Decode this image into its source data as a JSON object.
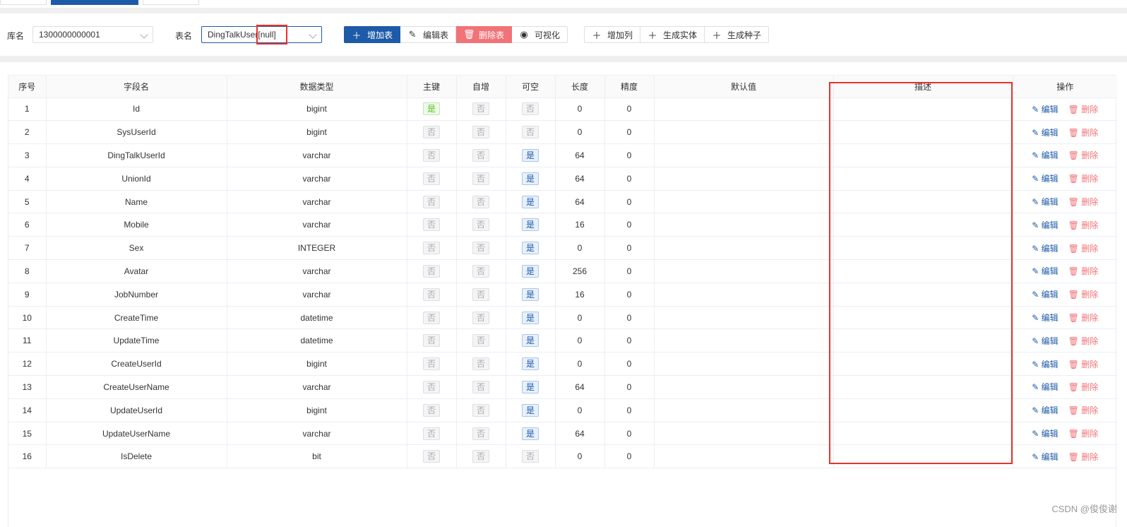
{
  "toolbar": {
    "db_label": "库名",
    "db_value": "1300000000001",
    "table_label": "表名",
    "table_value": "DingTalkUser[null]",
    "buttons_main": [
      {
        "icon": "plus-icon",
        "glyph": "＋",
        "label": "增加表"
      },
      {
        "icon": "edit-icon",
        "glyph": "✎",
        "label": "编辑表"
      },
      {
        "icon": "trash-icon",
        "glyph": "🗑",
        "label": "删除表"
      },
      {
        "icon": "eye-icon",
        "glyph": "◉",
        "label": "可视化"
      }
    ],
    "buttons_extra": [
      {
        "icon": "plus-icon",
        "glyph": "＋",
        "label": "增加列"
      },
      {
        "icon": "plus-icon",
        "glyph": "＋",
        "label": "生成实体"
      },
      {
        "icon": "plus-icon",
        "glyph": "＋",
        "label": "生成种子"
      }
    ]
  },
  "table": {
    "headers": [
      "序号",
      "字段名",
      "数据类型",
      "主键",
      "自增",
      "可空",
      "长度",
      "精度",
      "默认值",
      "描述",
      "操作"
    ],
    "yes": "是",
    "no": "否",
    "edit_label": "编辑",
    "delete_label": "删除",
    "rows": [
      {
        "no": "1",
        "name": "Id",
        "type": "bigint",
        "pk": true,
        "ai": false,
        "nullable": false,
        "length": "0",
        "precision": "0",
        "default": "",
        "desc": ""
      },
      {
        "no": "2",
        "name": "SysUserId",
        "type": "bigint",
        "pk": false,
        "ai": false,
        "nullable": false,
        "length": "0",
        "precision": "0",
        "default": "",
        "desc": ""
      },
      {
        "no": "3",
        "name": "DingTalkUserId",
        "type": "varchar",
        "pk": false,
        "ai": false,
        "nullable": true,
        "length": "64",
        "precision": "0",
        "default": "",
        "desc": ""
      },
      {
        "no": "4",
        "name": "UnionId",
        "type": "varchar",
        "pk": false,
        "ai": false,
        "nullable": true,
        "length": "64",
        "precision": "0",
        "default": "",
        "desc": ""
      },
      {
        "no": "5",
        "name": "Name",
        "type": "varchar",
        "pk": false,
        "ai": false,
        "nullable": true,
        "length": "64",
        "precision": "0",
        "default": "",
        "desc": ""
      },
      {
        "no": "6",
        "name": "Mobile",
        "type": "varchar",
        "pk": false,
        "ai": false,
        "nullable": true,
        "length": "16",
        "precision": "0",
        "default": "",
        "desc": ""
      },
      {
        "no": "7",
        "name": "Sex",
        "type": "INTEGER",
        "pk": false,
        "ai": false,
        "nullable": true,
        "length": "0",
        "precision": "0",
        "default": "",
        "desc": ""
      },
      {
        "no": "8",
        "name": "Avatar",
        "type": "varchar",
        "pk": false,
        "ai": false,
        "nullable": true,
        "length": "256",
        "precision": "0",
        "default": "",
        "desc": ""
      },
      {
        "no": "9",
        "name": "JobNumber",
        "type": "varchar",
        "pk": false,
        "ai": false,
        "nullable": true,
        "length": "16",
        "precision": "0",
        "default": "",
        "desc": ""
      },
      {
        "no": "10",
        "name": "CreateTime",
        "type": "datetime",
        "pk": false,
        "ai": false,
        "nullable": true,
        "length": "0",
        "precision": "0",
        "default": "",
        "desc": ""
      },
      {
        "no": "11",
        "name": "UpdateTime",
        "type": "datetime",
        "pk": false,
        "ai": false,
        "nullable": true,
        "length": "0",
        "precision": "0",
        "default": "",
        "desc": ""
      },
      {
        "no": "12",
        "name": "CreateUserId",
        "type": "bigint",
        "pk": false,
        "ai": false,
        "nullable": true,
        "length": "0",
        "precision": "0",
        "default": "",
        "desc": ""
      },
      {
        "no": "13",
        "name": "CreateUserName",
        "type": "varchar",
        "pk": false,
        "ai": false,
        "nullable": true,
        "length": "64",
        "precision": "0",
        "default": "",
        "desc": ""
      },
      {
        "no": "14",
        "name": "UpdateUserId",
        "type": "bigint",
        "pk": false,
        "ai": false,
        "nullable": true,
        "length": "0",
        "precision": "0",
        "default": "",
        "desc": ""
      },
      {
        "no": "15",
        "name": "UpdateUserName",
        "type": "varchar",
        "pk": false,
        "ai": false,
        "nullable": true,
        "length": "64",
        "precision": "0",
        "default": "",
        "desc": ""
      },
      {
        "no": "16",
        "name": "IsDelete",
        "type": "bit",
        "pk": false,
        "ai": false,
        "nullable": false,
        "length": "0",
        "precision": "0",
        "default": "",
        "desc": ""
      }
    ]
  },
  "watermark": "CSDN @俊俊谢",
  "colors": {
    "primary": "#1d5aa8",
    "danger": "#f07378",
    "success": "#52c41a",
    "highlight": "#e8322b"
  }
}
